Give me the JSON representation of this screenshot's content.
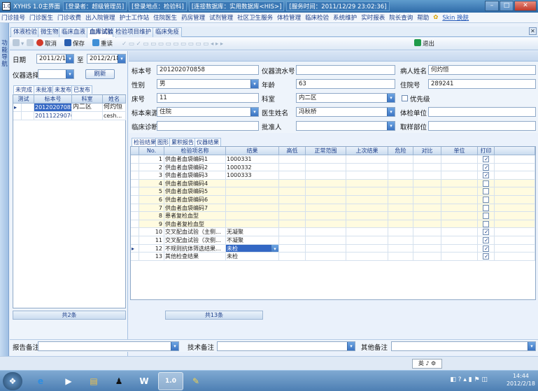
{
  "title": {
    "app": "XYHIS 1.0主界面",
    "user": "[登录者：超级管理员]",
    "location": "[登录地点：检验科]",
    "db": "[连接数据库：实用数据库<HIS>]",
    "time": "[服务时间：2011/12/29 23:02:36]"
  },
  "menu": [
    "门诊挂号",
    "门诊医生",
    "门诊收费",
    "出入院管理",
    "护士工作站",
    "住院医生",
    "药房管理",
    "试剂管理",
    "社区卫生服务",
    "体检管理",
    "临床检验",
    "系统维护",
    "实时报表",
    "院长查询",
    "帮助"
  ],
  "menu_skin": "Skin 换肤",
  "left_strip": "功能导航",
  "tabs": [
    "体液检验",
    "微生物",
    "临床血液",
    "血库试验",
    "检验项目维护",
    "临床免疫"
  ],
  "active_tab": "血库试验",
  "toolbar": {
    "cancel": "取消",
    "save": "保存",
    "reload": "重读",
    "exit": "退出"
  },
  "left": {
    "date_label": "日期",
    "date_from": "2011/2/18",
    "to_label": "至",
    "date_to": "2012/2/18",
    "instrument_label": "仪器选择",
    "refresh": "刷新",
    "subtabs": [
      "未完成",
      "未批准",
      "未发布",
      "已发布"
    ],
    "cols": [
      "测试",
      "标本号",
      "科室",
      "姓名"
    ],
    "rows": [
      {
        "sample": "201202070858",
        "dept": "内二区",
        "name": "何灼恒"
      },
      {
        "sample": "201112290766",
        "dept": "",
        "name": "cesh..."
      }
    ],
    "count": "共2条"
  },
  "form": {
    "sample_label": "标本号",
    "sample": "201202070858",
    "inst_label": "仪器流水号",
    "inst": "",
    "patient_label": "病人姓名",
    "patient": "何灼恒",
    "sex_label": "性别",
    "sex": "男",
    "age_label": "年龄",
    "age": "63",
    "inp_label": "住院号",
    "inp": "289241",
    "bed_label": "床号",
    "bed": "11",
    "dept_label": "科室",
    "dept": "内二区",
    "priority_label": "优先级",
    "source_label": "标本来源",
    "source": "住院",
    "doctor_label": "医生姓名",
    "doctor": "冯秋桥",
    "unit_label": "体检单位",
    "unit": "",
    "diag_label": "临床诊断",
    "diag": "",
    "approver_label": "批准人",
    "approver": "",
    "site_label": "取样部位",
    "site": ""
  },
  "result_tabs": [
    "检验结果",
    "图形",
    "累积报告",
    "仪器结果"
  ],
  "result_cols": [
    "No.",
    "检验项名称",
    "结果",
    "高低",
    "正常范围",
    "上次结果",
    "危险",
    "对比",
    "单位",
    "打印"
  ],
  "results": [
    {
      "no": "1",
      "name": "供血者血袋编码1",
      "value": "1000331"
    },
    {
      "no": "2",
      "name": "供血者血袋编码2",
      "value": "1000332"
    },
    {
      "no": "3",
      "name": "供血者血袋编码3",
      "value": "1000333"
    },
    {
      "no": "4",
      "name": "供血者血袋编码4",
      "value": ""
    },
    {
      "no": "5",
      "name": "供血者血袋编码5",
      "value": ""
    },
    {
      "no": "6",
      "name": "供血者血袋编码6",
      "value": ""
    },
    {
      "no": "7",
      "name": "供血者血袋编码7",
      "value": ""
    },
    {
      "no": "8",
      "name": "患者复检血型",
      "value": ""
    },
    {
      "no": "9",
      "name": "供血者复检血型",
      "value": ""
    },
    {
      "no": "10",
      "name": "交叉配血试验（主侧...",
      "value": "无凝聚"
    },
    {
      "no": "11",
      "name": "交叉配血试验（次侧...",
      "value": "不凝聚"
    },
    {
      "no": "12",
      "name": "不规则抗体筛选结果...",
      "value": "未检"
    },
    {
      "no": "13",
      "name": "其他检查结果",
      "value": "未检"
    }
  ],
  "result_count": "共13条",
  "bottom": {
    "report_label": "报告备注",
    "tech_label": "技术备注",
    "other_label": "其他备注"
  },
  "ime": "英 ♪ ⚙",
  "clock": {
    "time": "14:44",
    "date": "2012/2/18"
  }
}
